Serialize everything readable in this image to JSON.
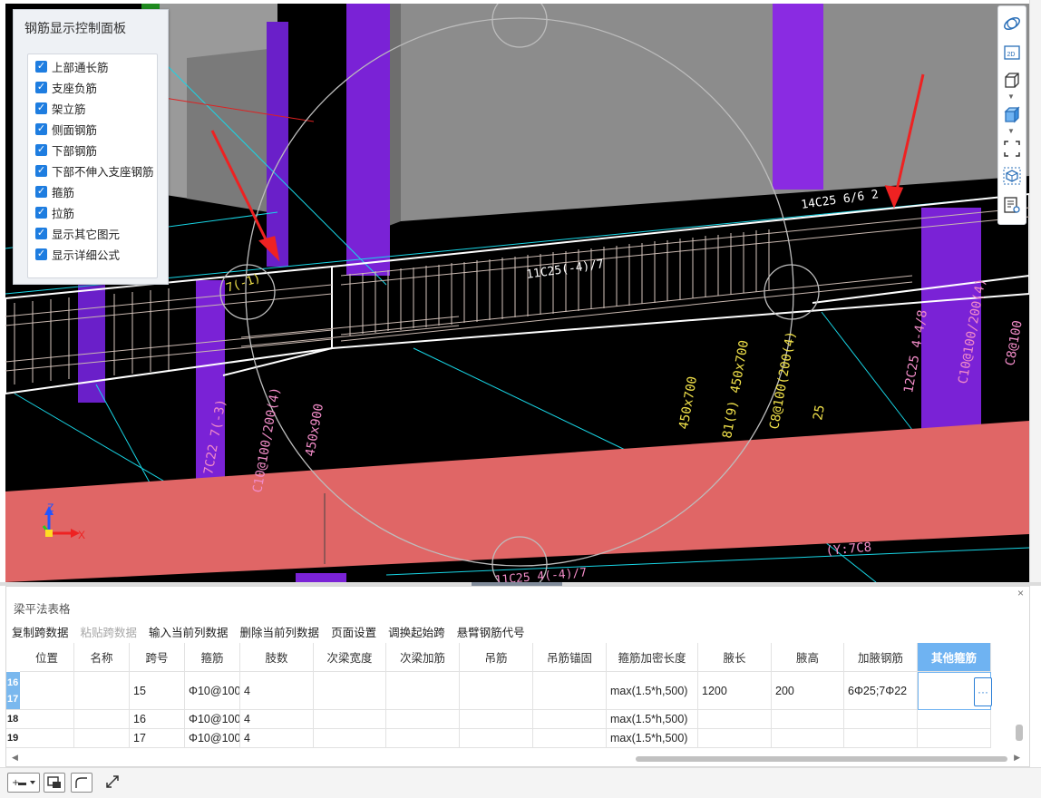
{
  "rebar_panel": {
    "title": "钢筋显示控制面板",
    "items": [
      {
        "label": "上部通长筋",
        "checked": true
      },
      {
        "label": "支座负筋",
        "checked": true
      },
      {
        "label": "架立筋",
        "checked": true
      },
      {
        "label": "侧面钢筋",
        "checked": true
      },
      {
        "label": "下部钢筋",
        "checked": true
      },
      {
        "label": "下部不伸入支座钢筋",
        "checked": true
      },
      {
        "label": "箍筋",
        "checked": true
      },
      {
        "label": "拉筋",
        "checked": true
      },
      {
        "label": "显示其它图元",
        "checked": true
      },
      {
        "label": "显示详细公式",
        "checked": true
      }
    ]
  },
  "view_toolbar": {
    "icons": [
      "orbit-icon",
      "2d-view-icon",
      "3d-box-icon",
      "solid-box-icon",
      "select-region-icon",
      "view-cube-icon",
      "display-settings-icon"
    ],
    "label_2d": "2D"
  },
  "scene_labels": {
    "beam_left": "11C25(-4)/7",
    "beam_right": "14C25 6/6 2",
    "right_col": "12C25 4-4/8",
    "dims_1": "450x700",
    "dims_2": "81(9) 450x700",
    "dims_3": "C8@100(200(4)",
    "dims_4": "25",
    "left_stirrup": "C10@100/200(4)",
    "left_dims": "450x900",
    "left_bar": "7C22 7(-3)",
    "right_a": "C10@100/200(4)",
    "right_b": "C8@100",
    "bottom_label": "11C25 4(-4)/7",
    "bottom_right": "(Y:7C8",
    "top_small": "7(-1)",
    "axis_z": "Z",
    "axis_x": "X",
    "axis_y": "Y"
  },
  "table_panel": {
    "title": "梁平法表格",
    "close": "×",
    "toolbar": [
      {
        "label": "复制跨数据",
        "enabled": true
      },
      {
        "label": "粘贴跨数据",
        "enabled": false
      },
      {
        "label": "输入当前列数据",
        "enabled": true
      },
      {
        "label": "删除当前列数据",
        "enabled": true
      },
      {
        "label": "页面设置",
        "enabled": true
      },
      {
        "label": "调换起始跨",
        "enabled": true
      },
      {
        "label": "悬臂钢筋代号",
        "enabled": true
      }
    ],
    "columns": [
      "位置",
      "名称",
      "跨号",
      "箍筋",
      "肢数",
      "次梁宽度",
      "次梁加筋",
      "吊筋",
      "吊筋锚固",
      "箍筋加密长度",
      "腋长",
      "腋高",
      "加腋钢筋",
      "其他箍筋"
    ],
    "active_column": "其他箍筋",
    "rows": [
      {
        "nums": [
          "16",
          "17"
        ],
        "cells": [
          "",
          "",
          "15",
          "Φ10@100",
          "4",
          "",
          "",
          "",
          "",
          "max(1.5*h,500)",
          "1200",
          "200",
          "6Φ25;7Φ22",
          ""
        ]
      },
      {
        "nums": [
          "18"
        ],
        "cells": [
          "",
          "",
          "16",
          "Φ10@100",
          "4",
          "",
          "",
          "",
          "",
          "max(1.5*h,500)",
          "",
          "",
          "",
          ""
        ]
      },
      {
        "nums": [
          "19"
        ],
        "cells": [
          "",
          "",
          "17",
          "Φ10@100",
          "4",
          "",
          "",
          "",
          "",
          "max(1.5*h,500)",
          "",
          "",
          "",
          ""
        ]
      }
    ],
    "ellipsis": "···"
  },
  "statusbar": {
    "icons": [
      "add-layer-icon",
      "screen-capture-icon",
      "curve-tool-icon",
      "fullscreen-icon"
    ]
  },
  "colors": {
    "beam_red": "#e06666",
    "column_purple": "#7a22d6",
    "slab_gray": "#8c8c8c",
    "cyan_line": "#18d6e6",
    "yellow_label": "#f2e24a",
    "pink_label": "#f28cc8",
    "table_active": "#6fb3f2"
  }
}
